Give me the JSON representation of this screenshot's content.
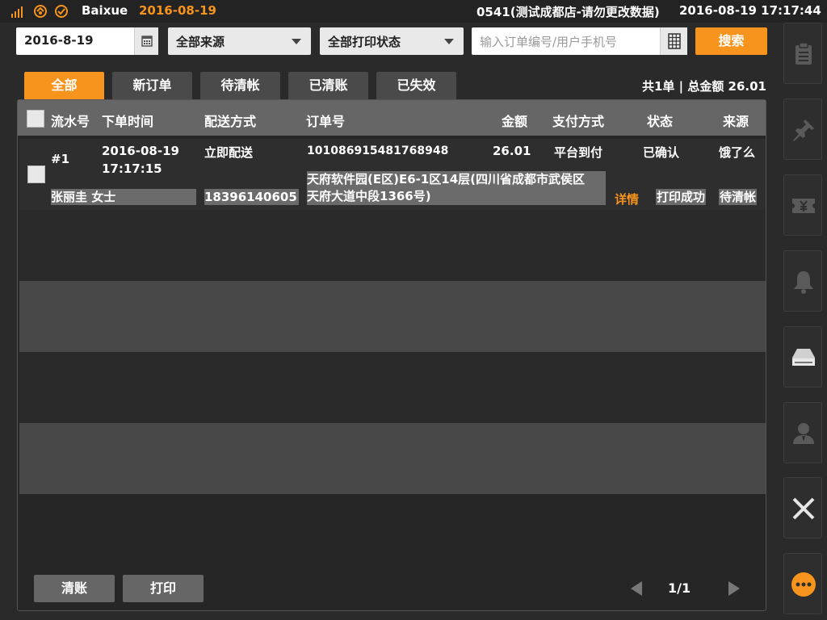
{
  "status_bar": {
    "user": "Baixue",
    "date": "2016-08-19",
    "store": "0541(测试成都店-请勿更改数据)",
    "datetime": "2016-08-19 17:17:44",
    "icons": [
      "signal-icon",
      "sync-icon",
      "check-circle-icon"
    ]
  },
  "filters": {
    "date_value": "2016-8-19",
    "source_selected": "全部来源",
    "print_status_selected": "全部打印状态",
    "search_placeholder": "输入订单编号/用户手机号",
    "search_label": "搜索"
  },
  "tabs": [
    {
      "label": "全部",
      "active": true
    },
    {
      "label": "新订单",
      "active": false
    },
    {
      "label": "待清帐",
      "active": false
    },
    {
      "label": "已清账",
      "active": false
    },
    {
      "label": "已失效",
      "active": false
    }
  ],
  "summary": "共1单 | 总金额 26.01",
  "table": {
    "headers": {
      "serial": "流水号",
      "order_time": "下单时间",
      "delivery": "配送方式",
      "order_no": "订单号",
      "amount": "金额",
      "payment": "支付方式",
      "status": "状态",
      "source": "来源"
    },
    "rows": [
      {
        "serial": "#1",
        "date": "2016-08-19",
        "time": "17:17:15",
        "delivery": "立即配送",
        "order_no": "101086915481768948",
        "amount": "26.01",
        "payment": "平台到付",
        "status": "已确认",
        "source": "饿了么",
        "customer": "张丽圭 女士",
        "phone": "18396140605",
        "address_line1": "天府软件园(E区)E6-1区14层(四川省成都市武侯区",
        "address_line2": "天府大道中段1366号)",
        "detail_link": "详情",
        "print_state": "打印成功",
        "settle_state": "待清帐"
      }
    ]
  },
  "footer": {
    "settle_label": "清账",
    "print_label": "打印",
    "page_text": "1/1"
  },
  "right_rail": [
    "clipboard-icon",
    "pin-icon",
    "ticket-yuan-icon",
    "bell-icon",
    "printer-icon",
    "user-icon",
    "close-icon",
    "more-icon"
  ],
  "colors": {
    "accent": "#f7941d",
    "header_bg": "#666666",
    "panel_bg": "#262626"
  }
}
